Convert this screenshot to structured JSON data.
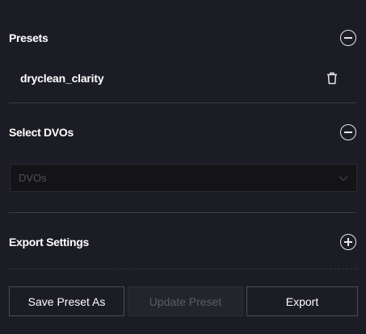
{
  "presets": {
    "title": "Presets",
    "items": [
      {
        "label": "dryclean_clarity"
      }
    ]
  },
  "select_dvos": {
    "title": "Select DVOs",
    "select_value": "DVOs"
  },
  "export_settings": {
    "title": "Export Settings"
  },
  "actions": {
    "save_preset_as": "Save Preset As",
    "update_preset": "Update Preset",
    "export": "Export"
  },
  "colors": {
    "background": "#1c1d24",
    "divider": "#3a3b44",
    "text": "#ffffff",
    "disabled_text": "#5b5c66"
  },
  "icons": {
    "presets_toggle": "minus-circle-icon",
    "select_dvos_toggle": "minus-circle-icon",
    "export_settings_toggle": "plus-circle-icon",
    "delete": "trash-icon",
    "dropdown": "chevron-down-icon"
  }
}
